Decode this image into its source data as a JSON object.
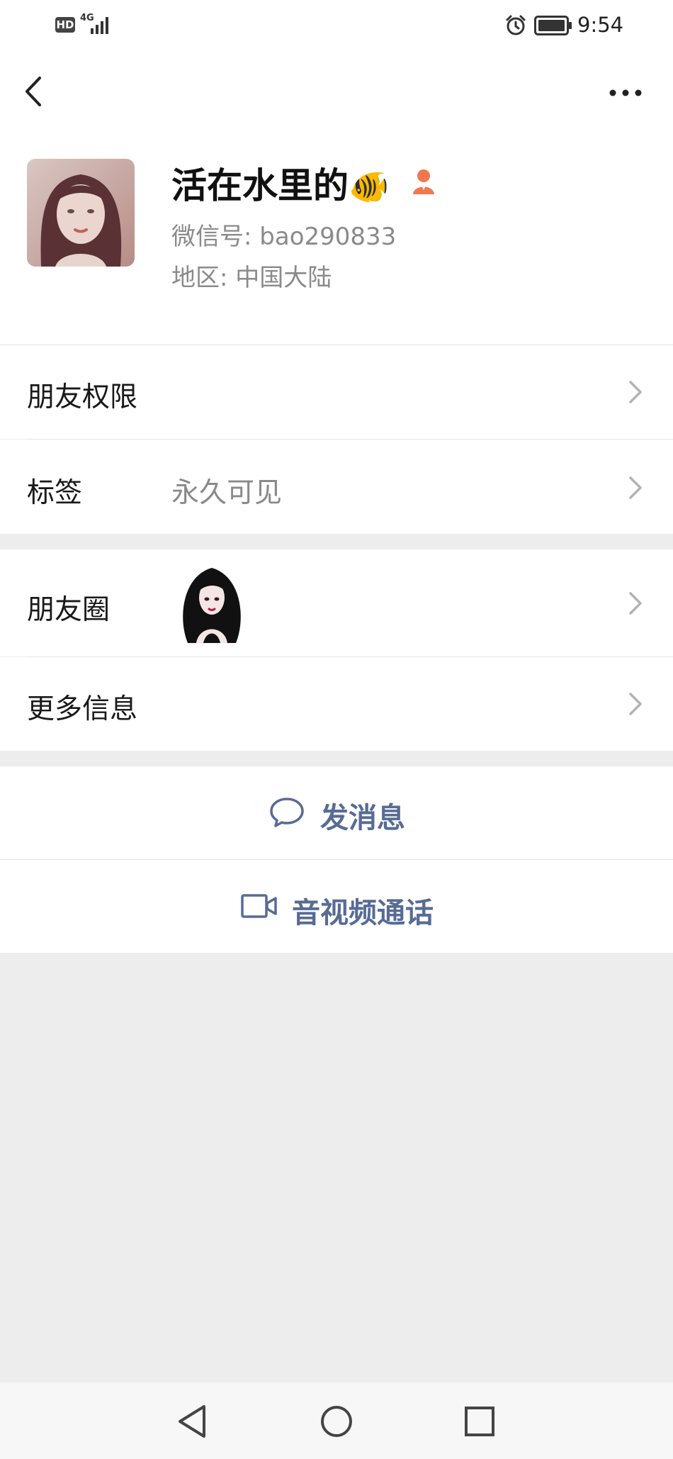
{
  "status_bar": {
    "network_hd": "HD",
    "network_type": "4G",
    "time": "9:54",
    "icons": [
      "hd-icon",
      "signal-icon",
      "alarm-icon",
      "battery-icon"
    ]
  },
  "header": {
    "back_icon": "back-chevron-icon",
    "more_icon": "more-dots-icon"
  },
  "profile": {
    "nickname": "活在水里的",
    "nickname_emoji": "🐠",
    "gender_icon": "female-person-icon",
    "wechat_id_label": "微信号:",
    "wechat_id": "bao290833",
    "region_label": "地区:",
    "region": "中国大陆"
  },
  "section1": {
    "rows": [
      {
        "label": "朋友权限",
        "value": ""
      },
      {
        "label": "标签",
        "value": "永久可见"
      }
    ]
  },
  "section2": {
    "rows": [
      {
        "label": "朋友圈",
        "value": ""
      },
      {
        "label": "更多信息",
        "value": ""
      }
    ]
  },
  "actions": {
    "message_label": "发消息",
    "message_icon": "chat-bubble-icon",
    "call_label": "音视频通话",
    "call_icon": "video-camera-icon"
  },
  "nav": {
    "icons": [
      "nav-back-icon",
      "nav-home-icon",
      "nav-recents-icon"
    ]
  },
  "colors": {
    "accent_blue": "#576b95",
    "gender_orange": "#f07850",
    "background_gray": "#ededed"
  }
}
